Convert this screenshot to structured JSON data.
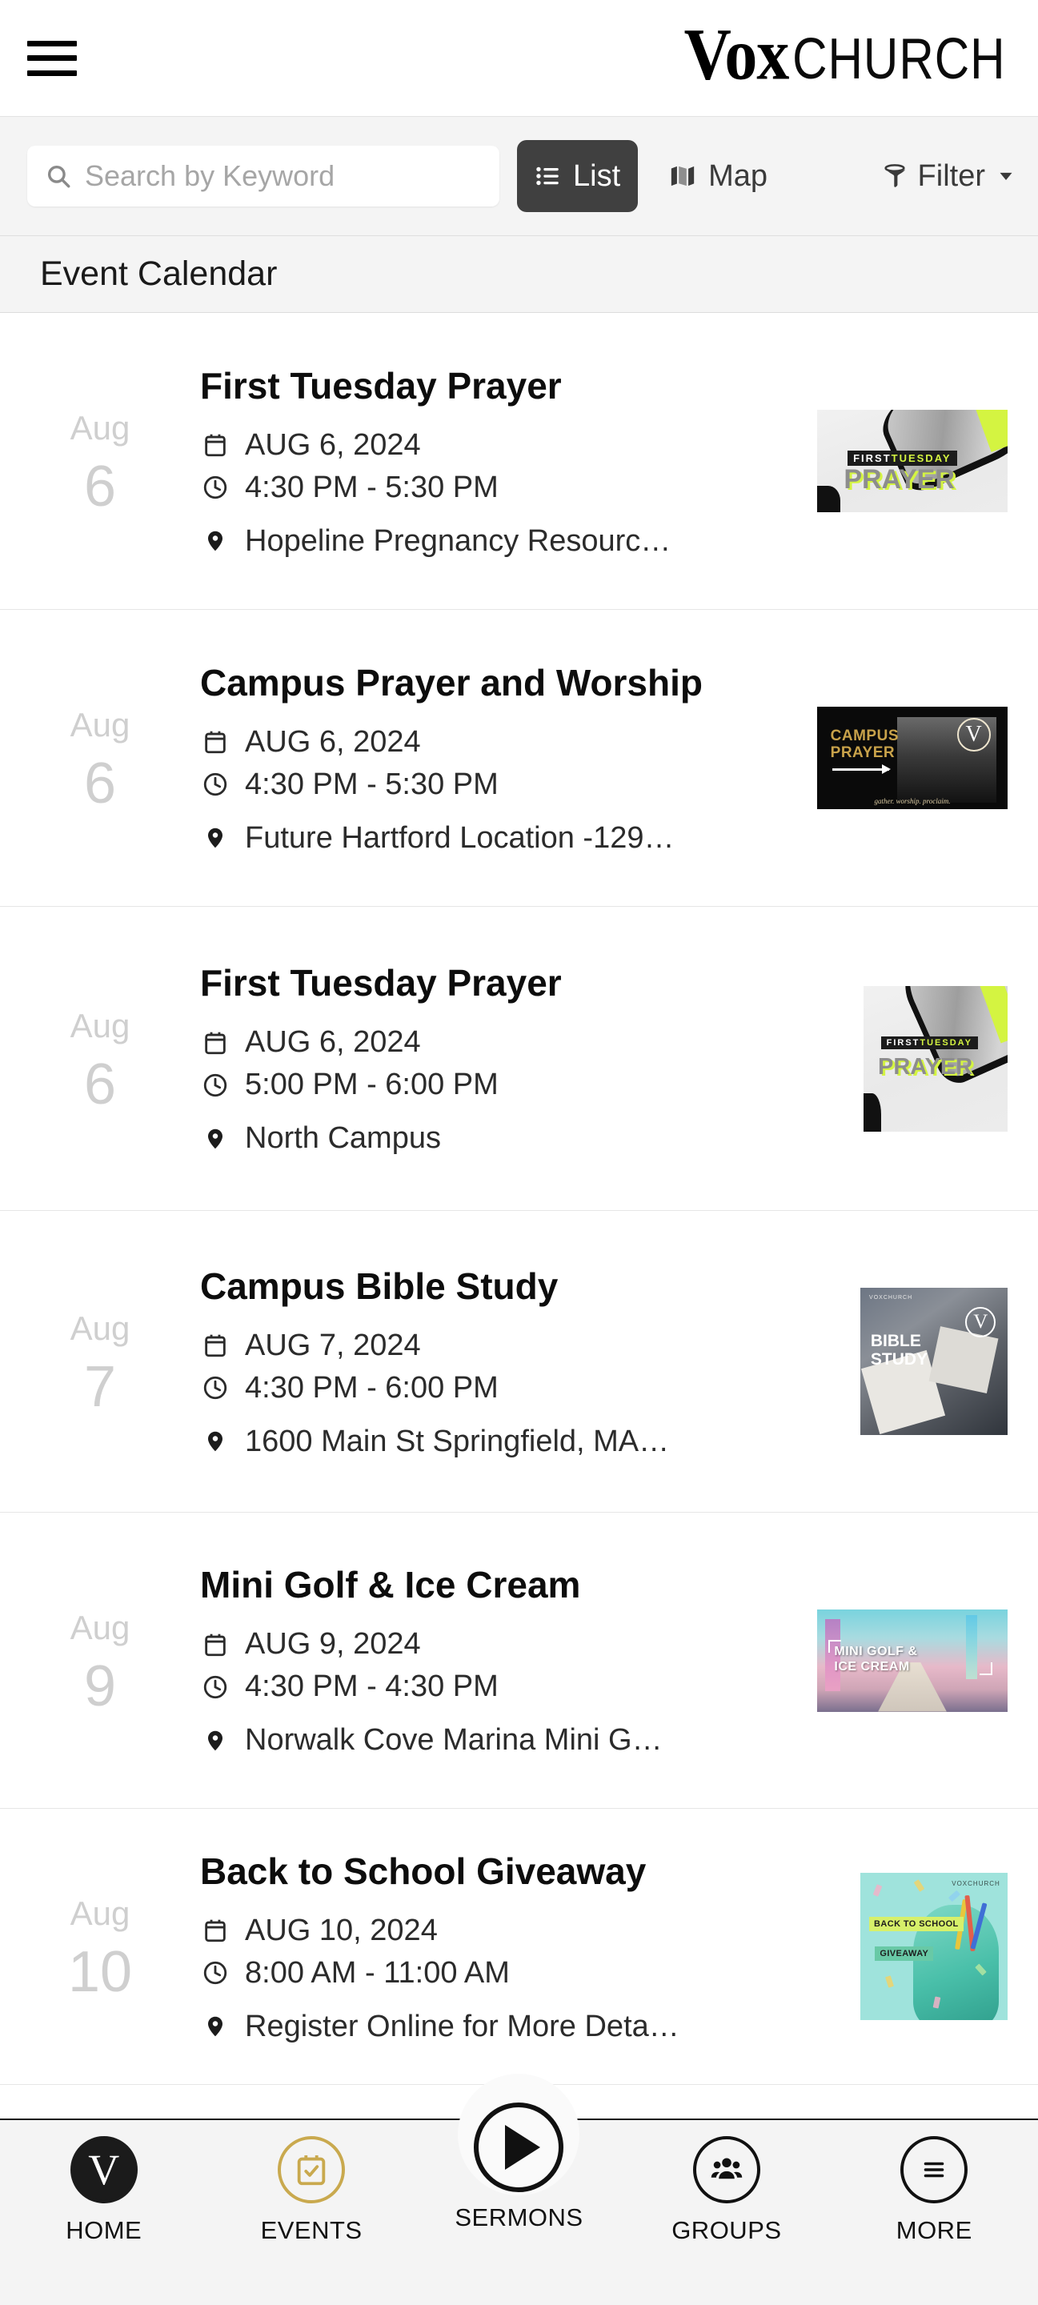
{
  "header": {
    "menu_icon": "hamburger-icon",
    "brand_primary": "Vox",
    "brand_primary_lead": "V",
    "brand_primary_rest": "OX",
    "brand_secondary": "CHURCH"
  },
  "toolbar": {
    "search_placeholder": "Search by Keyword",
    "search_value": "",
    "search_icon": "search-icon",
    "list_label": "List",
    "list_icon": "list-icon",
    "map_label": "Map",
    "map_icon": "map-icon",
    "filter_label": "Filter",
    "filter_icon": "funnel-icon",
    "filter_caret": "▼",
    "active_view": "List",
    "active_bg": "#404040"
  },
  "section": {
    "title": "Event Calendar"
  },
  "events": [
    {
      "month": "Aug",
      "day": "6",
      "title": "First Tuesday Prayer",
      "date": "AUG 6, 2024",
      "time": "4:30 PM - 5:30 PM",
      "location": "Hopeline Pregnancy Resourc…",
      "thumb_kind": "first-tuesday-prayer-wide",
      "thumb_text_1": "FIRSTTUESDAY",
      "thumb_text_2": "PRAYER"
    },
    {
      "month": "Aug",
      "day": "6",
      "title": "Campus Prayer and Worship",
      "date": "AUG 6, 2024",
      "time": "4:30 PM - 5:30 PM",
      "location": "Future Hartford Location -129…",
      "thumb_kind": "campus-prayer",
      "thumb_text_1": "CAMPUS",
      "thumb_text_2": "PRAYER"
    },
    {
      "month": "Aug",
      "day": "6",
      "title": "First Tuesday Prayer",
      "date": "AUG 6, 2024",
      "time": "5:00 PM - 6:00 PM",
      "location": "North Campus",
      "thumb_kind": "first-tuesday-prayer-tall",
      "thumb_text_1": "FIRSTTUESDAY",
      "thumb_text_2": "PRAYER"
    },
    {
      "month": "Aug",
      "day": "7",
      "title": "Campus Bible Study",
      "date": "AUG 7, 2024",
      "time": "4:30 PM - 6:00 PM",
      "location": "1600 Main St Springfield, MA…",
      "thumb_kind": "bible-study",
      "thumb_text_1": "BIBLE",
      "thumb_text_2": "STUDY"
    },
    {
      "month": "Aug",
      "day": "9",
      "title": "Mini Golf & Ice Cream",
      "date": "AUG 9, 2024",
      "time": "4:30 PM - 4:30 PM",
      "location": "Norwalk Cove Marina Mini G…",
      "thumb_kind": "mini-golf",
      "thumb_text_1": "MINI GOLF &",
      "thumb_text_2": "ICE CREAM"
    },
    {
      "month": "Aug",
      "day": "10",
      "title": "Back to School Giveaway",
      "date": "AUG 10, 2024",
      "time": "8:00 AM - 11:00 AM",
      "location": "Register Online for More Deta…",
      "thumb_kind": "back-to-school",
      "thumb_text_1": "BACK TO SCHOOL",
      "thumb_text_2": "GIVEAWAY"
    }
  ],
  "bottom_nav": {
    "items": [
      {
        "label": "HOME",
        "icon": "vox-v-icon"
      },
      {
        "label": "EVENTS",
        "icon": "calendar-check-icon"
      },
      {
        "label": "SERMONS",
        "icon": "play-icon"
      },
      {
        "label": "GROUPS",
        "icon": "people-icon"
      },
      {
        "label": "MORE",
        "icon": "hamburger-icon"
      }
    ],
    "home_letter": "V",
    "events_accent": "#c9a94e"
  }
}
